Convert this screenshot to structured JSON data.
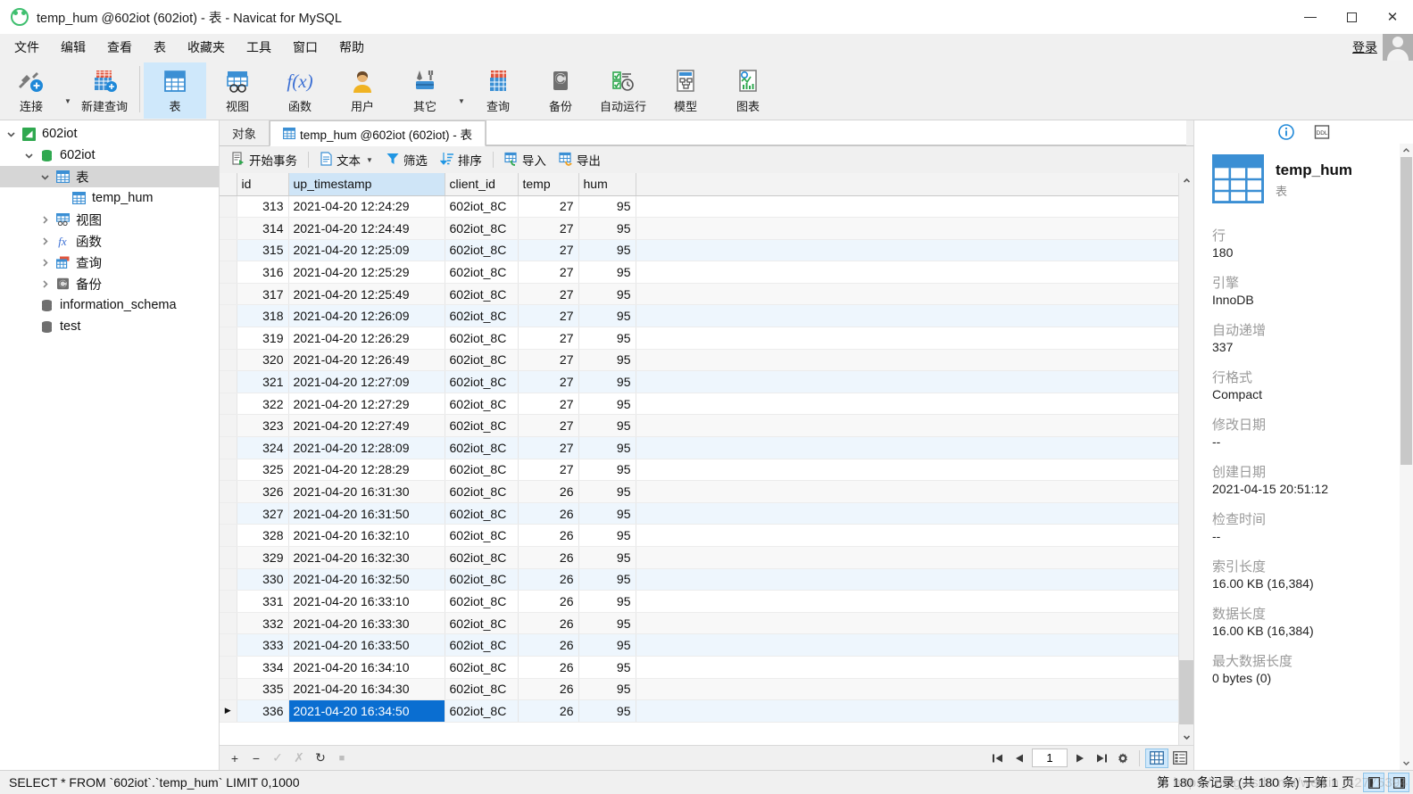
{
  "window": {
    "title": "temp_hum @602iot (602iot) - 表 - Navicat for MySQL",
    "logo_icon": "navicat-logo-icon",
    "minimize_label": "最小化",
    "maximize_label": "最大化",
    "close_label": "关闭"
  },
  "menubar": {
    "items": [
      {
        "label": "文件"
      },
      {
        "label": "编辑"
      },
      {
        "label": "查看"
      },
      {
        "label": "表"
      },
      {
        "label": "收藏夹"
      },
      {
        "label": "工具"
      },
      {
        "label": "窗口"
      },
      {
        "label": "帮助"
      }
    ],
    "login_label": "登录",
    "avatar_icon": "user-avatar-icon"
  },
  "ribbon": {
    "items": [
      {
        "label": "连接",
        "icon": "connection-icon",
        "active": false,
        "caret": true
      },
      {
        "label": "新建查询",
        "icon": "new-query-icon",
        "active": false,
        "caret": false
      },
      {
        "label": "表",
        "icon": "table-icon",
        "active": true,
        "caret": false
      },
      {
        "label": "视图",
        "icon": "view-icon",
        "active": false,
        "caret": false
      },
      {
        "label": "函数",
        "icon": "function-icon",
        "active": false,
        "caret": false
      },
      {
        "label": "用户",
        "icon": "user-icon",
        "active": false,
        "caret": false
      },
      {
        "label": "其它",
        "icon": "other-tools-icon",
        "active": false,
        "caret": true
      },
      {
        "label": "查询",
        "icon": "query-icon",
        "active": false,
        "caret": false
      },
      {
        "label": "备份",
        "icon": "backup-icon",
        "active": false,
        "caret": false
      },
      {
        "label": "自动运行",
        "icon": "automation-icon",
        "active": false,
        "caret": false
      },
      {
        "label": "模型",
        "icon": "model-icon",
        "active": false,
        "caret": false
      },
      {
        "label": "图表",
        "icon": "chart-icon",
        "active": false,
        "caret": false
      }
    ]
  },
  "tree": {
    "nodes": [
      {
        "label": "602iot",
        "indent": 0,
        "twisty": "down",
        "icon": "connection-node-icon",
        "selected": false
      },
      {
        "label": "602iot",
        "indent": 1,
        "twisty": "down",
        "icon": "database-icon",
        "selected": false
      },
      {
        "label": "表",
        "indent": 2,
        "twisty": "down",
        "icon": "tables-folder-icon",
        "selected": true
      },
      {
        "label": "temp_hum",
        "indent": 3,
        "twisty": "none",
        "icon": "table-item-icon",
        "selected": false
      },
      {
        "label": "视图",
        "indent": 2,
        "twisty": "right",
        "icon": "views-folder-icon",
        "selected": false
      },
      {
        "label": "函数",
        "indent": 2,
        "twisty": "right",
        "icon": "functions-folder-icon",
        "selected": false
      },
      {
        "label": "查询",
        "indent": 2,
        "twisty": "right",
        "icon": "queries-folder-icon",
        "selected": false
      },
      {
        "label": "备份",
        "indent": 2,
        "twisty": "right",
        "icon": "backups-folder-icon",
        "selected": false
      },
      {
        "label": "information_schema",
        "indent": 1,
        "twisty": "none",
        "icon": "database-icon",
        "selected": false
      },
      {
        "label": "test",
        "indent": 1,
        "twisty": "none",
        "icon": "database-icon",
        "selected": false
      }
    ]
  },
  "tabs": [
    {
      "label": "对象",
      "active": false,
      "icon": "none"
    },
    {
      "label": "temp_hum @602iot (602iot) - 表",
      "active": true,
      "icon": "table-item-icon"
    }
  ],
  "actionbar": {
    "items": [
      {
        "label": "开始事务",
        "icon": "begin-transaction-icon",
        "caret": false
      },
      {
        "label": "文本",
        "icon": "text-icon",
        "caret": true
      },
      {
        "label": "筛选",
        "icon": "filter-icon",
        "caret": false
      },
      {
        "label": "排序",
        "icon": "sort-icon",
        "caret": false
      },
      {
        "label": "导入",
        "icon": "import-icon",
        "caret": false
      },
      {
        "label": "导出",
        "icon": "export-icon",
        "caret": false
      }
    ]
  },
  "grid": {
    "columns": [
      {
        "key": "id",
        "label": "id",
        "highlight": false
      },
      {
        "key": "up_timestamp",
        "label": "up_timestamp",
        "highlight": true
      },
      {
        "key": "client_id",
        "label": "client_id",
        "highlight": false
      },
      {
        "key": "temp",
        "label": "temp",
        "highlight": false
      },
      {
        "key": "hum",
        "label": "hum",
        "highlight": false
      }
    ],
    "selected_row_index": 23,
    "selected_column_key": "up_timestamp",
    "rows": [
      {
        "id": "313",
        "up_timestamp": "2021-04-20 12:24:29",
        "client_id": "602iot_8C",
        "temp": "27",
        "hum": "95"
      },
      {
        "id": "314",
        "up_timestamp": "2021-04-20 12:24:49",
        "client_id": "602iot_8C",
        "temp": "27",
        "hum": "95"
      },
      {
        "id": "315",
        "up_timestamp": "2021-04-20 12:25:09",
        "client_id": "602iot_8C",
        "temp": "27",
        "hum": "95"
      },
      {
        "id": "316",
        "up_timestamp": "2021-04-20 12:25:29",
        "client_id": "602iot_8C",
        "temp": "27",
        "hum": "95"
      },
      {
        "id": "317",
        "up_timestamp": "2021-04-20 12:25:49",
        "client_id": "602iot_8C",
        "temp": "27",
        "hum": "95"
      },
      {
        "id": "318",
        "up_timestamp": "2021-04-20 12:26:09",
        "client_id": "602iot_8C",
        "temp": "27",
        "hum": "95"
      },
      {
        "id": "319",
        "up_timestamp": "2021-04-20 12:26:29",
        "client_id": "602iot_8C",
        "temp": "27",
        "hum": "95"
      },
      {
        "id": "320",
        "up_timestamp": "2021-04-20 12:26:49",
        "client_id": "602iot_8C",
        "temp": "27",
        "hum": "95"
      },
      {
        "id": "321",
        "up_timestamp": "2021-04-20 12:27:09",
        "client_id": "602iot_8C",
        "temp": "27",
        "hum": "95"
      },
      {
        "id": "322",
        "up_timestamp": "2021-04-20 12:27:29",
        "client_id": "602iot_8C",
        "temp": "27",
        "hum": "95"
      },
      {
        "id": "323",
        "up_timestamp": "2021-04-20 12:27:49",
        "client_id": "602iot_8C",
        "temp": "27",
        "hum": "95"
      },
      {
        "id": "324",
        "up_timestamp": "2021-04-20 12:28:09",
        "client_id": "602iot_8C",
        "temp": "27",
        "hum": "95"
      },
      {
        "id": "325",
        "up_timestamp": "2021-04-20 12:28:29",
        "client_id": "602iot_8C",
        "temp": "27",
        "hum": "95"
      },
      {
        "id": "326",
        "up_timestamp": "2021-04-20 16:31:30",
        "client_id": "602iot_8C",
        "temp": "26",
        "hum": "95"
      },
      {
        "id": "327",
        "up_timestamp": "2021-04-20 16:31:50",
        "client_id": "602iot_8C",
        "temp": "26",
        "hum": "95"
      },
      {
        "id": "328",
        "up_timestamp": "2021-04-20 16:32:10",
        "client_id": "602iot_8C",
        "temp": "26",
        "hum": "95"
      },
      {
        "id": "329",
        "up_timestamp": "2021-04-20 16:32:30",
        "client_id": "602iot_8C",
        "temp": "26",
        "hum": "95"
      },
      {
        "id": "330",
        "up_timestamp": "2021-04-20 16:32:50",
        "client_id": "602iot_8C",
        "temp": "26",
        "hum": "95"
      },
      {
        "id": "331",
        "up_timestamp": "2021-04-20 16:33:10",
        "client_id": "602iot_8C",
        "temp": "26",
        "hum": "95"
      },
      {
        "id": "332",
        "up_timestamp": "2021-04-20 16:33:30",
        "client_id": "602iot_8C",
        "temp": "26",
        "hum": "95"
      },
      {
        "id": "333",
        "up_timestamp": "2021-04-20 16:33:50",
        "client_id": "602iot_8C",
        "temp": "26",
        "hum": "95"
      },
      {
        "id": "334",
        "up_timestamp": "2021-04-20 16:34:10",
        "client_id": "602iot_8C",
        "temp": "26",
        "hum": "95"
      },
      {
        "id": "335",
        "up_timestamp": "2021-04-20 16:34:30",
        "client_id": "602iot_8C",
        "temp": "26",
        "hum": "95"
      },
      {
        "id": "336",
        "up_timestamp": "2021-04-20 16:34:50",
        "client_id": "602iot_8C",
        "temp": "26",
        "hum": "95"
      }
    ]
  },
  "record_nav": {
    "add_label": "+",
    "remove_label": "−",
    "apply_label": "✓",
    "cancel_label": "✗",
    "refresh_label": "↻",
    "stop_label": "■",
    "first_label": "|←",
    "prev_label": "←",
    "page_value": "1",
    "next_label": "→",
    "last_label": "→|",
    "settings_label": "⚙",
    "grid_view_label": "网格查看",
    "form_view_label": "表单查看"
  },
  "statusbar": {
    "sql": "SELECT * FROM `602iot`.`temp_hum` LIMIT 0,1000",
    "record_info": "第 180 条记录  (共 180 条)  于第 1 页"
  },
  "info_panel": {
    "tabs": [
      {
        "name": "info-tab",
        "icon": "info-circle-icon",
        "active": true
      },
      {
        "name": "ddl-tab",
        "icon": "ddl-icon",
        "active": false
      }
    ],
    "object_icon": "table-large-icon",
    "object_name": "temp_hum",
    "object_type": "表",
    "fields": [
      {
        "label": "行",
        "value": "180"
      },
      {
        "label": "引擎",
        "value": "InnoDB"
      },
      {
        "label": "自动递增",
        "value": "337"
      },
      {
        "label": "行格式",
        "value": "Compact"
      },
      {
        "label": "修改日期",
        "value": "--"
      },
      {
        "label": "创建日期",
        "value": "2021-04-15 20:51:12"
      },
      {
        "label": "检查时间",
        "value": "--"
      },
      {
        "label": "索引长度",
        "value": "16.00 KB (16,384)"
      },
      {
        "label": "数据长度",
        "value": "16.00 KB (16,384)"
      },
      {
        "label": "最大数据长度",
        "value": "0 bytes (0)"
      }
    ]
  },
  "watermark": "https://blog.csdn.net/weixin_42775394",
  "colors": {
    "accent": "#0a6ed1",
    "ribbon_active": "#cfe8fb",
    "header_highlight": "#cfe5f7",
    "alt_row": "#eef6fd"
  }
}
